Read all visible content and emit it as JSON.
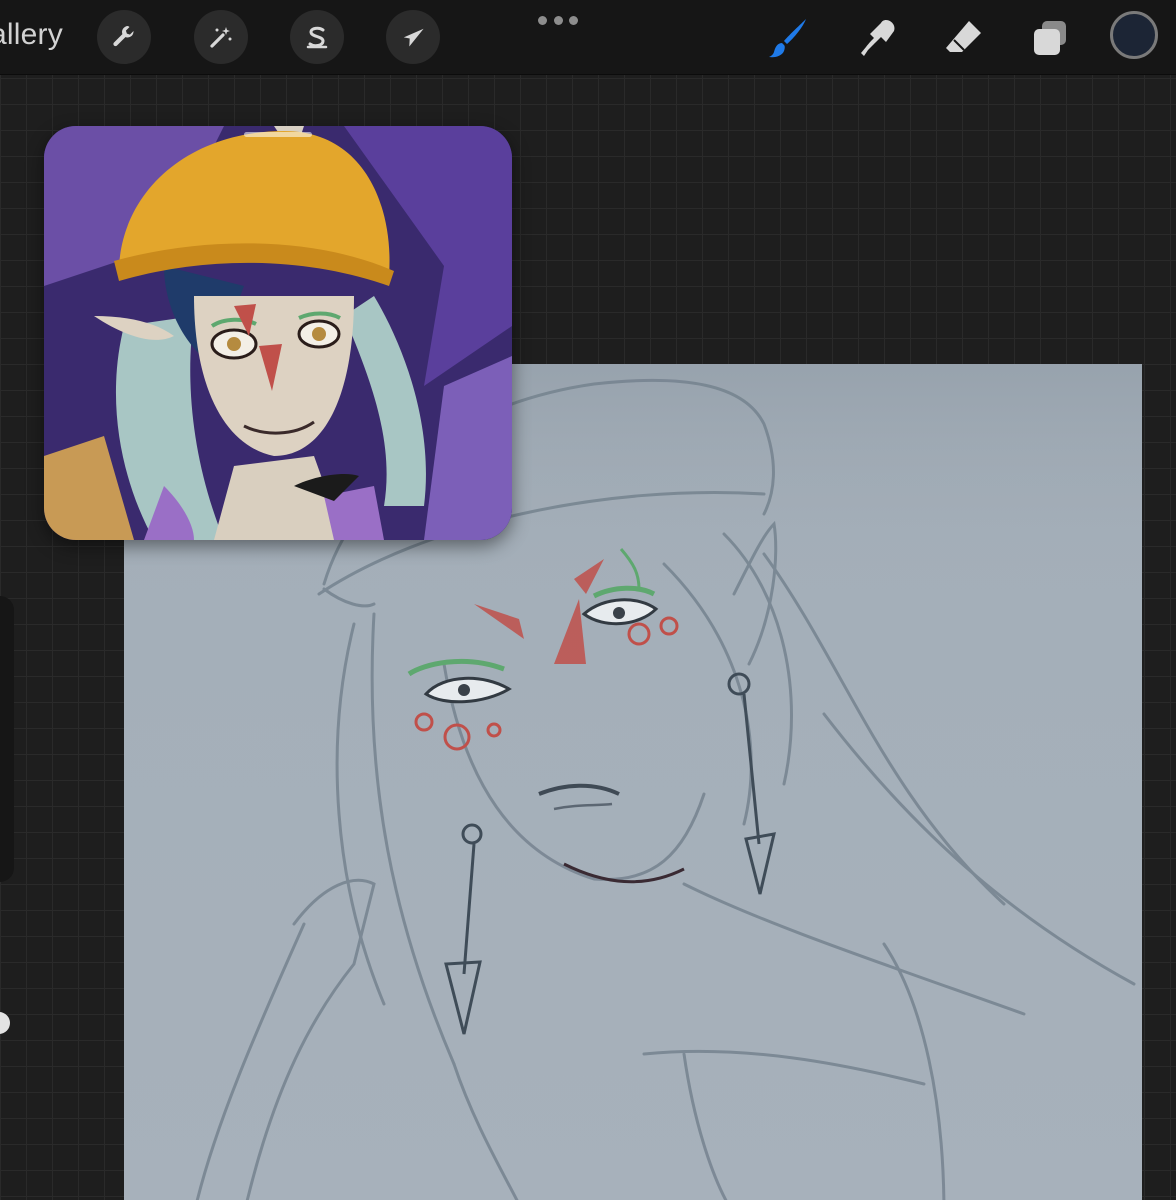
{
  "toolbar": {
    "gallery_label": "allery",
    "actions_icon": "wrench-icon",
    "adjustments_icon": "magic-wand-icon",
    "selection_icon": "selection-s-icon",
    "transform_icon": "arrow-cursor-icon",
    "more_icon": "ellipsis-icon",
    "brush_icon": "paintbrush-icon",
    "smudge_icon": "smudge-finger-icon",
    "eraser_icon": "eraser-icon",
    "layers_icon": "layers-icon",
    "active_tool_color": "#1f7ae8",
    "current_color": "#1c2535"
  },
  "sidebar": {
    "brush_size_level": 0.3,
    "opacity_level": 0.85
  },
  "canvas": {
    "background_color": "#a4afb9",
    "sketch_color": "#6f7d89",
    "accent_red": "#c0504a",
    "accent_green": "#5ea86f"
  },
  "reference": {
    "image": "reference-portrait",
    "hat_color": "#e3a62c",
    "background_color": "#4b3585"
  }
}
